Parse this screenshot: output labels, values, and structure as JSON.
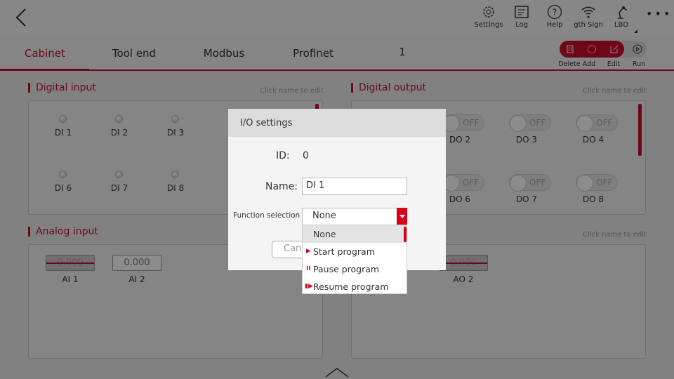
{
  "header": {
    "back": "back-icon",
    "items": [
      {
        "label": "Settings",
        "icon": "gear-icon"
      },
      {
        "label": "Log",
        "icon": "log-icon"
      },
      {
        "label": "Help",
        "icon": "help-icon"
      },
      {
        "label": "gth  Sign",
        "icon": "wifi-icon"
      },
      {
        "label": "LBD",
        "icon": "robot-arm-icon"
      }
    ],
    "more": "more-icon"
  },
  "tabs": [
    {
      "label": "Cabinet",
      "active": true
    },
    {
      "label": "Tool end"
    },
    {
      "label": "Modbus"
    },
    {
      "label": "Profinet"
    },
    {
      "label": "1"
    }
  ],
  "toolbar": {
    "delete": "Delete",
    "add": "Add",
    "edit": "Edit",
    "run": "Run"
  },
  "digital_input": {
    "title": "Digital input",
    "hint": "Click name to edit",
    "items": [
      "DI 1",
      "DI 2",
      "DI 3",
      "DI 6",
      "DI 7",
      "DI 8"
    ]
  },
  "digital_output": {
    "title": "Digital output",
    "hint": "Click name to edit",
    "items": [
      {
        "name": "DO 2",
        "state": "OFF"
      },
      {
        "name": "DO 3",
        "state": "OFF"
      },
      {
        "name": "DO 4",
        "state": "OFF"
      },
      {
        "name": "DO 6",
        "state": "OFF"
      },
      {
        "name": "DO 7",
        "state": "OFF"
      },
      {
        "name": "DO 8",
        "state": "OFF"
      }
    ]
  },
  "analog_input": {
    "title": "Analog input",
    "items": [
      {
        "name": "AI 1",
        "value": "0.000"
      },
      {
        "name": "AI 2",
        "value": "0.000"
      }
    ]
  },
  "analog_output": {
    "hint": "Click name to edit",
    "items": [
      {
        "name": "AO 2",
        "value": "0.000"
      }
    ]
  },
  "dialog": {
    "title": "I/O settings",
    "id_label": "ID:",
    "id_value": "0",
    "name_label": "Name:",
    "name_value": "DI 1",
    "function_label": "Function selection",
    "function_value": "None",
    "cancel": "Canc",
    "options": [
      "None",
      "Start program",
      "Pause program",
      "Resume program"
    ]
  },
  "colors": {
    "accent": "#c8102e"
  }
}
